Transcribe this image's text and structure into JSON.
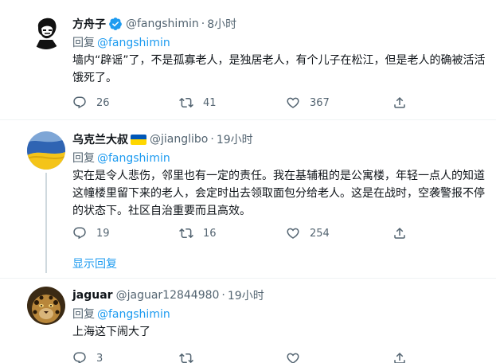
{
  "tweets": [
    {
      "name": "方舟子",
      "verified": true,
      "handle": "@fangshimin",
      "time": "8小时",
      "reply_label": "回复",
      "reply_to": "@fangshimin",
      "text": "墙内“辟谣”了，不是孤寡老人，是独居老人，有个儿子在松江，但是老人的确被活活饿死了。",
      "replies": "26",
      "retweets": "41",
      "likes": "367"
    },
    {
      "name": "乌克兰大叔",
      "flag": "ukraine-flag",
      "handle": "@jianglibo",
      "time": "19小时",
      "reply_label": "回复",
      "reply_to": "@fangshimin",
      "text": "实在是令人悲伤，邻里也有一定的责任。我在基辅租的是公寓楼，年轻一点人的知道这幢楼里留下来的老人，会定时出去领取面包分给老人。这是在战时，空袭警报不停的状态下。社区自治重要而且高效。",
      "replies": "19",
      "retweets": "16",
      "likes": "254",
      "show_replies": "显示回复"
    },
    {
      "name": "jaguar",
      "handle": "@jaguar12844980",
      "time": "19小时",
      "reply_label": "回复",
      "reply_to": "@fangshimin",
      "text": "上海这下闹大了",
      "replies": "3",
      "retweets": "",
      "likes": ""
    }
  ],
  "colors": {
    "accent": "#1d9bf0",
    "muted": "#536471",
    "text": "#0f1419",
    "divider": "#eff3f4"
  },
  "icons": [
    "reply-icon",
    "retweet-icon",
    "like-icon",
    "share-icon",
    "verified-badge-icon"
  ]
}
